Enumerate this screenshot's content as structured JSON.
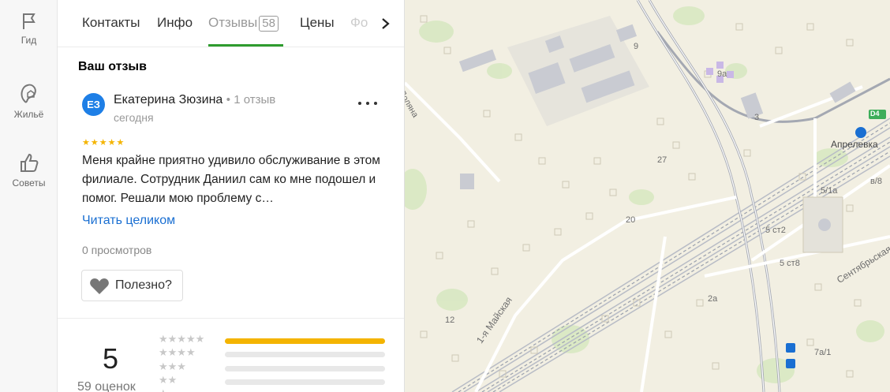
{
  "sidebar": {
    "items": [
      {
        "label": "Гид",
        "icon": "flag-icon"
      },
      {
        "label": "Жильё",
        "icon": "home-icon"
      },
      {
        "label": "Советы",
        "icon": "thumbs-up-icon"
      }
    ]
  },
  "tabs": [
    {
      "label": "Контакты"
    },
    {
      "label": "Инфо"
    },
    {
      "label": "Отзывы",
      "count": "58",
      "active": true
    },
    {
      "label": "Цены"
    },
    {
      "label": "Фо"
    }
  ],
  "review": {
    "section_title": "Ваш отзыв",
    "avatar_initials": "ЕЗ",
    "author": "Екатерина Зюзина",
    "author_meta": "1 отзыв",
    "date": "сегодня",
    "stars": "★★★★★",
    "text": "Меня крайне приятно удивило обслуживание в этом филиале. Сотрудник Даниил сам ко мне подошел и помог. Решали мою проблему с…",
    "read_more": "Читать целиком",
    "views": "0 просмотров",
    "useful_label": "Полезно?"
  },
  "rating_summary": {
    "average": "5",
    "count_label": "59 оценок",
    "distribution": [
      {
        "stars": "★★★★★",
        "fraction": 1.0
      },
      {
        "stars": "★★★★",
        "fraction": 0.0
      },
      {
        "stars": "★★★",
        "fraction": 0.0
      },
      {
        "stars": "★★",
        "fraction": 0.0
      },
      {
        "stars": "★",
        "fraction": 0.0
      }
    ]
  },
  "map": {
    "labels": {
      "street_polyana": "Поляна",
      "street_maiskaya": "1-я Майская",
      "street_sentyabrskaya": "Сентябрьская",
      "station": "Апрелевка",
      "route": "D4",
      "h9": "9",
      "h9a": "9а",
      "h3": "3",
      "h27": "27",
      "h20": "20",
      "h51a": "5/1а",
      "hv8": "в/8",
      "h5s2": "5 ст2",
      "h5s8": "5 ст8",
      "h2a": "2а",
      "h12": "12",
      "h7a1": "7а/1"
    },
    "colors": {
      "ground": "#f2efe2",
      "park": "#d6e8c0",
      "road": "#ffffff",
      "railway": "#b8bcc6",
      "accent": "#2e9c2e",
      "star": "#f4b400",
      "link": "#1a6fd2"
    }
  }
}
